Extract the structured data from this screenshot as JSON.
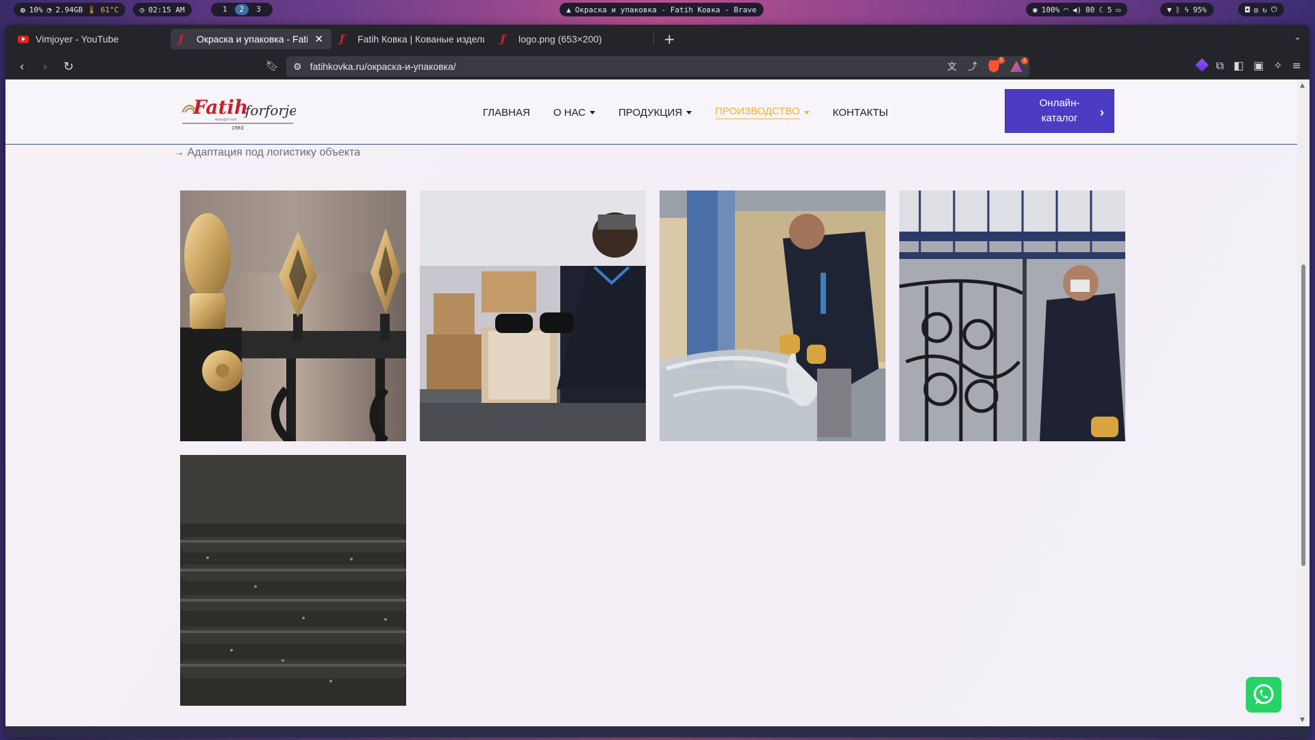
{
  "system_bar": {
    "stats": {
      "cpu": "10%",
      "mem": "2.94GB",
      "temp": "61°C"
    },
    "clock": "02:15 AM",
    "workspaces": [
      "1",
      "2",
      "3"
    ],
    "active_workspace": "2",
    "window_title": "Окраска и упаковка - Fatih Ковка - Brave",
    "status": {
      "brightness": "100%",
      "volume": "80",
      "moon": "5"
    },
    "battery": "95%"
  },
  "tabs": [
    {
      "title": "Vimjoyer - YouTube",
      "favicon": "youtube-icon",
      "active": false
    },
    {
      "title": "Окраска и упаковка - Fatih Ковка",
      "favicon": "fatih-icon",
      "active": true
    },
    {
      "title": "Fatih Ковка | Кованые изделия",
      "favicon": "fatih-icon",
      "active": false
    },
    {
      "title": "logo.png (653×200)",
      "favicon": "fatih-icon",
      "active": false
    }
  ],
  "address_bar": {
    "url": "fatihkovka.ru/окраска-и-упаковка/",
    "shield_count": "1",
    "rewards_count": "1"
  },
  "site": {
    "logo": {
      "brand": "Fatih",
      "script": "forforje",
      "tagline": "wrought iron",
      "year": "1983"
    },
    "nav": [
      {
        "label": "ГЛАВНАЯ",
        "dropdown": false,
        "current": false
      },
      {
        "label": "О НАС",
        "dropdown": true,
        "current": false
      },
      {
        "label": "ПРОДУКЦИЯ",
        "dropdown": true,
        "current": false
      },
      {
        "label": "ПРОИЗВОДСТВО",
        "dropdown": true,
        "current": true
      },
      {
        "label": "КОНТАКТЫ",
        "dropdown": false,
        "current": false
      }
    ],
    "catalog_button": {
      "line1": "Онлайн-",
      "line2": "каталог"
    },
    "list_item": "Адаптация под логистику объекта",
    "gallery": [
      {
        "subject": "gold-finial-fence-photo"
      },
      {
        "subject": "worker-packing-box-photo"
      },
      {
        "subject": "worker-wrapping-film-photo"
      },
      {
        "subject": "worker-inspecting-gate-photo"
      },
      {
        "subject": "dark-paint-fence-closeup-photo"
      }
    ]
  },
  "colors": {
    "accent": "#4c3cc4",
    "nav_current": "#f0b030",
    "logo_red": "#c8202a",
    "whatsapp": "#25d366"
  }
}
